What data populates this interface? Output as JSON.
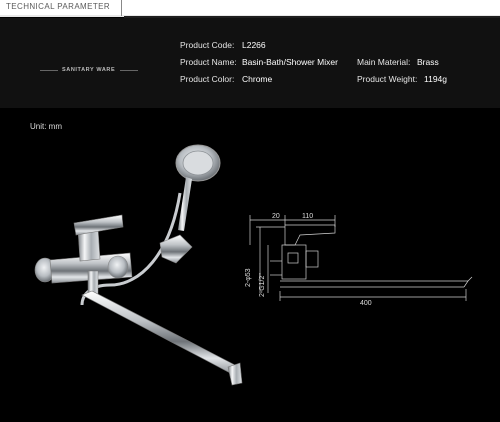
{
  "header": {
    "title": "TECHNICAL PARAMETER"
  },
  "brand": {
    "label": "SANITARY WARE"
  },
  "specs": {
    "product_code": {
      "label": "Product Code:",
      "value": "L2266"
    },
    "product_name": {
      "label": "Product Name:",
      "value": "Basin-Bath/Shower Mixer"
    },
    "product_color": {
      "label": "Product Color:",
      "value": "Chrome"
    },
    "main_material": {
      "label": "Main Material:",
      "value": "Brass"
    },
    "product_weight": {
      "label": "Product Weight:",
      "value": "1194g"
    }
  },
  "unit_note": "Unit: mm",
  "drawing": {
    "dim_20": "20",
    "dim_110": "110",
    "dim_88": "88",
    "dim_phi53": "2-φ53",
    "dim_g12": "2-G1/2\"",
    "dim_400": "400"
  }
}
